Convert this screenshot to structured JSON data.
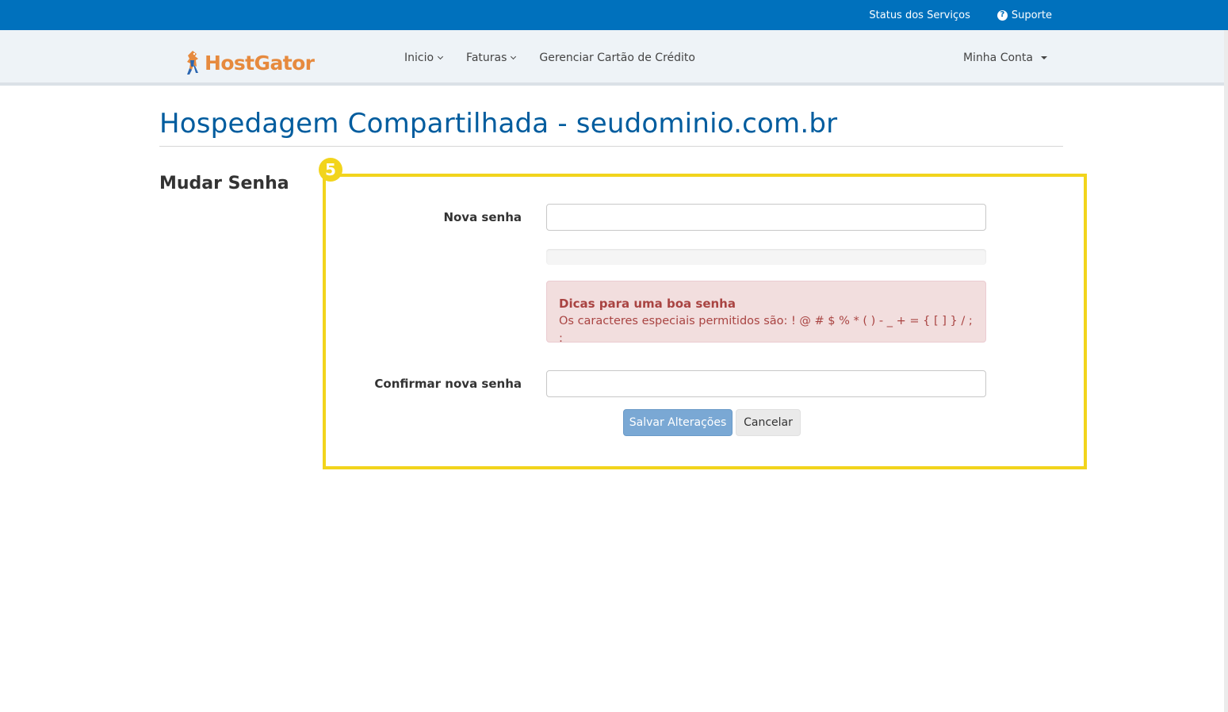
{
  "topbar": {
    "status_label": "Status dos Serviços",
    "support_label": "Suporte",
    "support_icon": "?"
  },
  "brand": {
    "logo_text": "HostGator",
    "logo_color": "#e68a3e"
  },
  "nav": {
    "items": [
      {
        "label": "Inicio"
      },
      {
        "label": "Faturas"
      },
      {
        "label": "Gerenciar Cartão de Crédito"
      }
    ],
    "account_label": "Minha Conta"
  },
  "page": {
    "title": "Hospedagem Compartilhada - seudominio.com.br",
    "section_heading": "Mudar Senha",
    "step_number": "5"
  },
  "form": {
    "new_password_label": "Nova senha",
    "new_password_value": "",
    "confirm_password_label": "Confirmar nova senha",
    "confirm_password_value": "",
    "strength_level": 0,
    "tips_title": "Dicas para uma boa senha",
    "tips_text": "Os caracteres especiais permitidos são: ! @ # $ % * ( ) - _ + = { [ ] } / ; :",
    "save_label": "Salvar Alterações",
    "cancel_label": "Cancelar"
  },
  "colors": {
    "topbar": "#0071bd",
    "title": "#005c9e",
    "highlight": "#f2d41c",
    "alert_bg": "#f2dede",
    "alert_text": "#a94442",
    "save_button": "#7aa8d4"
  }
}
